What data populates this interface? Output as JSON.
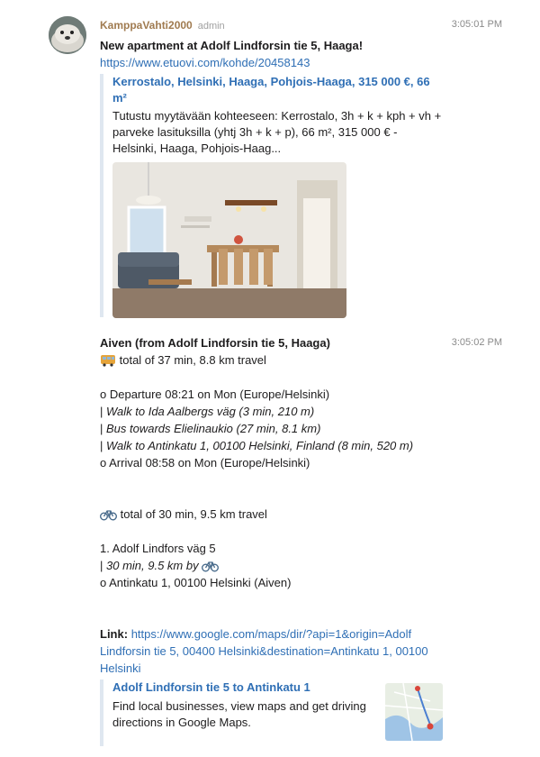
{
  "message1": {
    "username": "KamppaVahti2000",
    "role": "admin",
    "timestamp": "3:05:01 PM",
    "headline": "New apartment at Adolf Lindforsin tie 5, Haaga!",
    "link": "https://www.etuovi.com/kohde/20458143",
    "attachment": {
      "title_line1": "Kerrostalo, Helsinki, Haaga, Pohjois-Haaga, 315 000 €, 66",
      "title_line2": "m²",
      "desc_line1": "Tutustu myytävään kohteeseen: Kerrostalo, 3h + k + kph + vh +",
      "desc_line2": "parveke lasituksilla (yhtj 3h + k + p), 66 m², 315 000 € -",
      "desc_line3": "Helsinki, Haaga, Pohjois-Haag..."
    }
  },
  "message2": {
    "timestamp": "3:05:02 PM",
    "title": "Aiven (from Adolf Lindforsin tie 5, Haaga)",
    "transit": {
      "icon": "bus-icon",
      "summary": "total of 37 min, 8.8 km travel",
      "departure": "o  Departure 08:21 on Mon (Europe/Helsinki)",
      "steps": [
        {
          "prefix": "|  ",
          "text": "Walk to Ida Aalbergs väg (3 min, 210 m)"
        },
        {
          "prefix": "|  ",
          "text": "Bus towards Elielinaukio (27 min, 8.1 km)"
        },
        {
          "prefix": "|  ",
          "text": "Walk to Antinkatu 1, 00100 Helsinki, Finland (8 min, 520 m)"
        }
      ],
      "arrival": "o  Arrival 08:58 on Mon (Europe/Helsinki)"
    },
    "bike": {
      "icon": "bicycle-icon",
      "summary": "total of 30 min, 9.5 km travel",
      "start": "1. Adolf Lindfors väg 5",
      "step_prefix": "|  ",
      "step": "30 min, 9.5 km by",
      "end": "o  Antinkatu 1, 00100 Helsinki (Aiven)"
    },
    "link_label": "Link:",
    "link_line1": "https://www.google.com/maps/dir/?api=1&origin=Adolf",
    "link_line2": "Lindforsin tie 5, 00400 Helsinki&destination=Antinkatu 1, 00100",
    "link_line3": "Helsinki",
    "map_attachment": {
      "title": "Adolf Lindforsin tie 5 to Antinkatu 1",
      "desc_line1": "Find local businesses, view maps and get driving",
      "desc_line2": "directions in Google Maps."
    }
  }
}
